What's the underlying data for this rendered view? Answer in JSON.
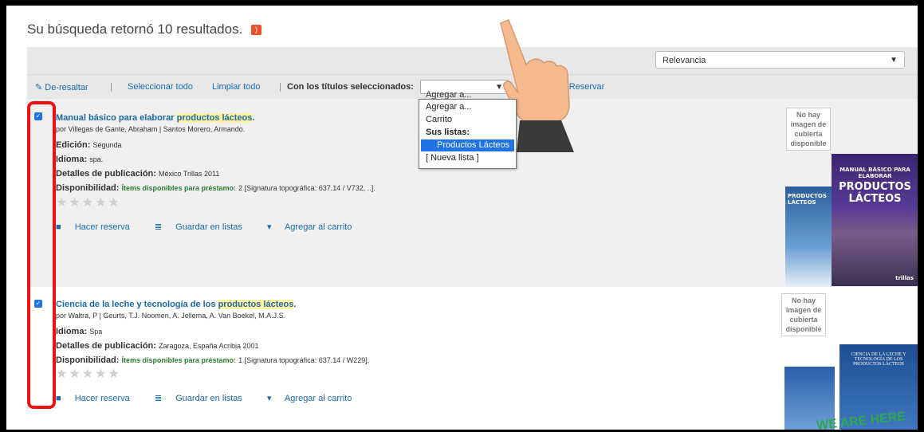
{
  "header": {
    "title": "Su búsqueda retornó 10 resultados."
  },
  "sort": {
    "value": "Relevancia"
  },
  "toolbar": {
    "unhighlight": "De-resaltar",
    "select_all": "Seleccionar todo",
    "clear_all": "Limpiar todo",
    "with_selected": "Con los títulos seleccionados:",
    "add_to_value": "Agregar a...",
    "reserve": "Reservar"
  },
  "dropdown": {
    "items": [
      "Agregar a...",
      "Carrito",
      "Sus listas:",
      "Productos Lácteos",
      "[ Nueva lista ]"
    ]
  },
  "results": [
    {
      "title_pre": "Manual básico para elaborar ",
      "title_hl": "productos lácteos",
      "title_post": ".",
      "author": "por Villegas de Gante, Abraham | Santos Morero, Armando.",
      "edition_label": "Edición:",
      "edition": "Segunda",
      "language_label": "Idioma:",
      "language": "spa.",
      "pub_label": "Detalles de publicación:",
      "pub": "México Trillas 2011",
      "avail_label": "Disponibilidad:",
      "avail_green": "Ítems disponibles para préstamo:",
      "avail_rest": "2 [Signatura topográfica: 637.14 / V732, ..].",
      "actions": [
        "Hacer reserva",
        "Guardar en listas",
        "Agregar al carrito"
      ],
      "no_image": "No hay imagen de cubierta disponible",
      "cover_text_small": "PRODUCTOS LÁCTEOS",
      "cover_text_large_top": "MANUAL BÁSICO PARA ELABORAR",
      "cover_text_large": "PRODUCTOS LÁCTEOS",
      "cover_publisher": "trillas"
    },
    {
      "title_pre": "Ciencia de la leche y tecnología de los ",
      "title_hl": "productos lácteos",
      "title_post": ".",
      "author": "por Waltra, P | Geurts, T.J. Noomen, A. Jellema, A. Van Boekel, M.A.J.S.",
      "language_label": "Idioma:",
      "language": "Spa",
      "pub_label": "Detalles de publicación:",
      "pub": "Zaragoza, España Acribia 2001",
      "avail_label": "Disponibilidad:",
      "avail_green": "Ítems disponibles para préstamo:",
      "avail_rest": "1 [Signatura topográfica: 637.14 / W229].",
      "actions": [
        "Hacer reserva",
        "Guardar en listas",
        "Agregar al carrito"
      ],
      "no_image": "No hay imagen de cubierta disponible",
      "cover_text": "CIENCIA DE LA LECHE Y TECNOLOGÍA DE LOS PRODUCTOS LÁCTEOS"
    }
  ],
  "overlay": {
    "watermark": "WE ARE HERE"
  },
  "colors": {
    "link": "#1a6aa8",
    "highlight": "#fff3a0",
    "accent": "#1e73e8",
    "annotation": "#e11111"
  }
}
